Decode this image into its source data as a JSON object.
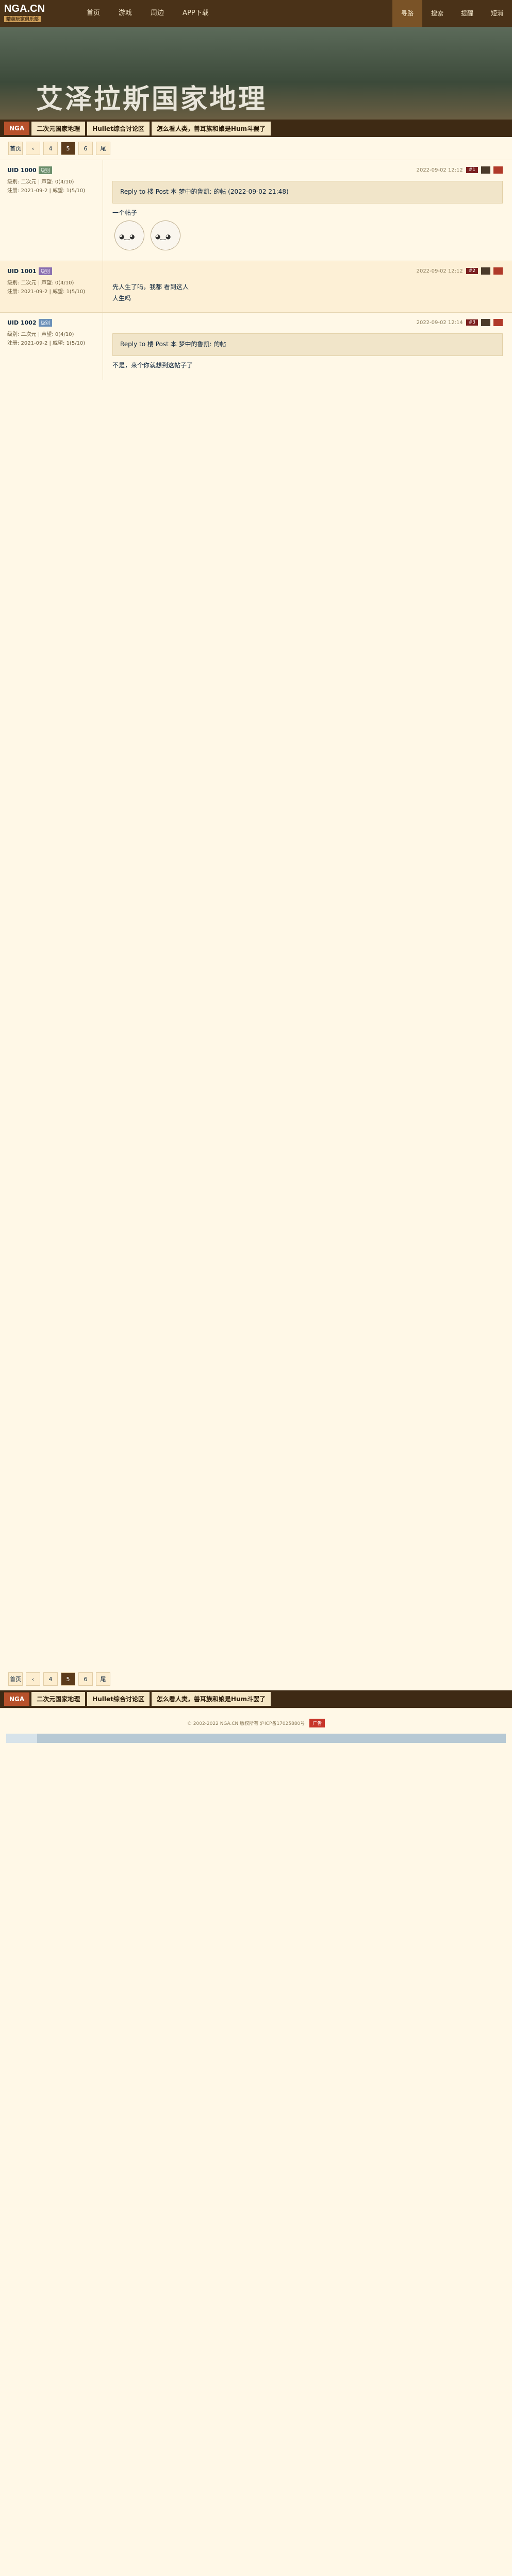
{
  "header": {
    "logo_text": "NGA.CN",
    "logo_sub": "精英玩家俱乐部",
    "nav": [
      "首页",
      "游戏",
      "周边",
      "APP下载"
    ],
    "right": [
      "寻路",
      "搜索",
      "提醒",
      "短消"
    ]
  },
  "banner": {
    "title": "艾泽拉斯国家地理"
  },
  "crumbs": [
    "NGA",
    "二次元国家地理",
    "Hullet综合讨论区",
    "怎么看人类，兽耳族和娘是Hum斗罢了"
  ],
  "pager": [
    "首页",
    "‹",
    "4",
    "5",
    "6",
    "尾"
  ],
  "posts": [
    {
      "user": "UID 1000",
      "badge": "级别",
      "rows": [
        "级别: 二次元 | 声望: 0(4/10)",
        "注册: 2021-09-2  | 威望: 1(5/10)"
      ],
      "floor": "#1",
      "time": "2022-09-02 12:12",
      "content": [
        "Reply to 楼 Post 本 梦中的鲁凯: 的帖 (2022-09-02 21:48)",
        "一个帖子"
      ]
    },
    {
      "user": "UID 1001",
      "badge": "级别",
      "rows": [
        "级别: 二次元 | 声望: 0(4/10)",
        "注册: 2021-09-2  | 威望: 1(5/10)"
      ],
      "floor": "#2",
      "time": "2022-09-02 12:12",
      "content": [
        "先人生了吗，我都 看到这人",
        "人生吗"
      ]
    },
    {
      "user": "UID 1002",
      "badge": "级别",
      "rows": [
        "级别: 二次元 | 声望: 0(4/10)",
        "注册: 2021-09-2  | 威望: 1(5/10)"
      ],
      "floor": "#3",
      "time": "2022-09-02 12:14",
      "content": [
        "Reply to 楼 Post 本 梦中的鲁凯: 的帖",
        "不是，来个你就想到这帖子了"
      ]
    }
  ],
  "footer": {
    "text": "© 2002-2022 NGA.CN  版权所有  沪ICP备17025880号",
    "ad": "广告"
  }
}
